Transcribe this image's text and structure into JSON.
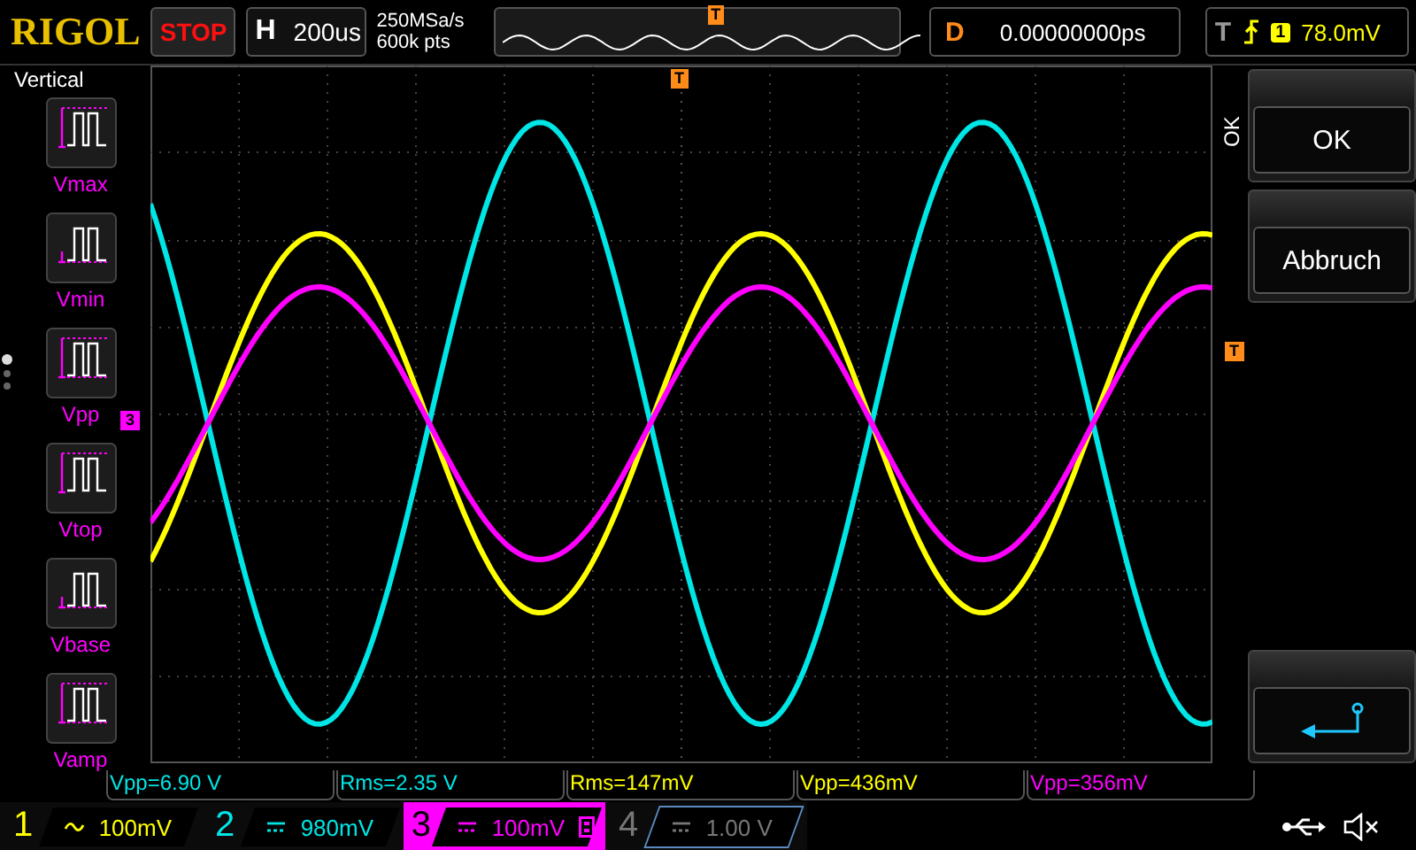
{
  "top_bar": {
    "logo": "RIGOL",
    "run_state": "STOP",
    "horizontal": {
      "label": "H",
      "value": "200us"
    },
    "sample_rate": "250MSa/s",
    "memory_depth": "600k pts",
    "overview_marker": "T",
    "delay": {
      "label": "D",
      "value": "0.00000000ps"
    },
    "trigger": {
      "label": "T",
      "source": "1",
      "level": "78.0mV"
    }
  },
  "menu": {
    "title": "Vertical",
    "items": [
      {
        "label": "Vmax",
        "kind": "vmax"
      },
      {
        "label": "Vmin",
        "kind": "vmin"
      },
      {
        "label": "Vpp",
        "kind": "vpp"
      },
      {
        "label": "Vtop",
        "kind": "vtop"
      },
      {
        "label": "Vbase",
        "kind": "vbase"
      },
      {
        "label": "Vamp",
        "kind": "vamp"
      }
    ],
    "page_dots": [
      {
        "selected": true
      },
      {
        "selected": false
      },
      {
        "selected": false
      }
    ]
  },
  "markers": {
    "trigger_position": "T",
    "trigger_level": "T",
    "channel": "3"
  },
  "side_panel": {
    "caption": "OK",
    "buttons": [
      {
        "label": "OK",
        "kind": "text"
      },
      {
        "label": "Abbruch",
        "kind": "text"
      },
      {
        "kind": "back"
      }
    ]
  },
  "measurements": [
    {
      "text": "Vpp=6.90 V",
      "color": "#00e5e5"
    },
    {
      "text": "Rms=2.35 V",
      "color": "#00e5e5"
    },
    {
      "text": "Rms=147mV",
      "color": "#ffff00"
    },
    {
      "text": "Vpp=436mV",
      "color": "#ffff00"
    },
    {
      "text": "Vpp=356mV",
      "color": "#ff00ff"
    }
  ],
  "channels": [
    {
      "number": "1",
      "kind": "ac",
      "scale": "100mV",
      "color": "#ffff00",
      "enabled": true,
      "selected": false,
      "bw_limit": false
    },
    {
      "number": "2",
      "kind": "dc",
      "scale": "980mV",
      "color": "#00e5e5",
      "enabled": true,
      "selected": false,
      "bw_limit": false
    },
    {
      "number": "3",
      "kind": "dc",
      "scale": "100mV",
      "color": "#ff00ff",
      "enabled": true,
      "selected": true,
      "bw_limit": true
    },
    {
      "number": "4",
      "kind": "dc",
      "scale": "1.00 V",
      "color": "#5a8ac0",
      "enabled": false,
      "selected": false,
      "bw_limit": false
    }
  ]
}
